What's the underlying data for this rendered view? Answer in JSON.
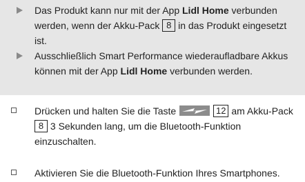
{
  "notes": [
    {
      "t1": "Das Produkt kann nur mit der App ",
      "b1": "Lidl Home",
      "t2": " verbunden werden, wenn der Akku-Pack ",
      "ref": "8",
      "t3": " in das Produkt eingesetzt ist."
    },
    {
      "t1": "Ausschließlich Smart Performance wiederaufladbare Akkus können mit der App ",
      "b1": "Lidl Home",
      "t2": " verbunden werden."
    }
  ],
  "steps": [
    {
      "t1": "Drücken und halten Sie die Taste ",
      "icon": "lightning-button-icon",
      "ref1": "12",
      "t2": " am Akku-Pack ",
      "ref2": "8",
      "t3": " 3 Sekunden lang, um die Bluetooth-Funktion einzuschalten."
    },
    {
      "t1": "Aktivieren Sie die Bluetooth-Funktion Ihres Smartphones."
    }
  ]
}
